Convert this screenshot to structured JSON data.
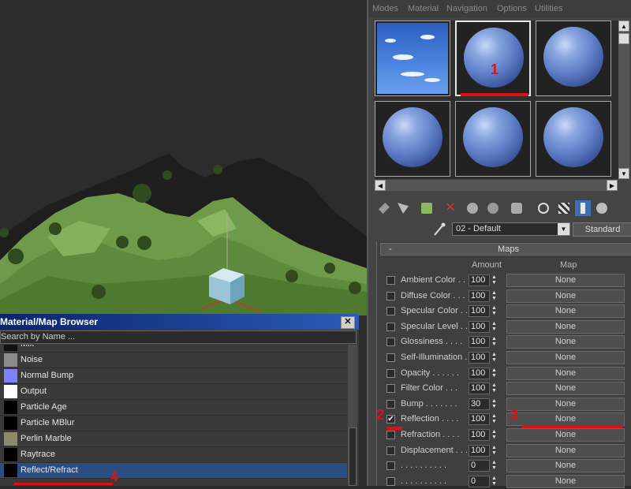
{
  "menu": [
    "Modes",
    "Material",
    "Navigation",
    "Options",
    "Utilities"
  ],
  "material_name": "02 - Default",
  "material_type": "Standard",
  "maps_rollout": {
    "title": "Maps",
    "collapse_symbol": "-",
    "col_amount": "Amount",
    "col_map": "Map",
    "rows": [
      {
        "label": "Ambient Color . .",
        "amount": "100",
        "map": "None",
        "checked": false
      },
      {
        "label": "Diffuse Color . . .",
        "amount": "100",
        "map": "None",
        "checked": false
      },
      {
        "label": "Specular Color . .",
        "amount": "100",
        "map": "None",
        "checked": false
      },
      {
        "label": "Specular Level . .",
        "amount": "100",
        "map": "None",
        "checked": false
      },
      {
        "label": "Glossiness . . . .",
        "amount": "100",
        "map": "None",
        "checked": false
      },
      {
        "label": "Self-Illumination .",
        "amount": "100",
        "map": "None",
        "checked": false
      },
      {
        "label": "Opacity . . . . . .",
        "amount": "100",
        "map": "None",
        "checked": false
      },
      {
        "label": "Filter Color . . .",
        "amount": "100",
        "map": "None",
        "checked": false
      },
      {
        "label": "Bump . . . . . . .",
        "amount": "30",
        "map": "None",
        "checked": false
      },
      {
        "label": "Reflection . . . .",
        "amount": "100",
        "map": "None",
        "checked": true
      },
      {
        "label": "Refraction . . . .",
        "amount": "100",
        "map": "None",
        "checked": false
      },
      {
        "label": "Displacement . . .",
        "amount": "100",
        "map": "None",
        "checked": false
      },
      {
        "label": ". . . . . . . . . .",
        "amount": "0",
        "map": "None",
        "checked": false
      },
      {
        "label": ". . . . . . . . . .",
        "amount": "0",
        "map": "None",
        "checked": false
      }
    ]
  },
  "browser": {
    "title": "Material/Map Browser",
    "close": "✕",
    "search_placeholder": "Search by Name ...",
    "items": [
      {
        "label": "Mix",
        "swatch": "#111111"
      },
      {
        "label": "Noise",
        "swatch": "#8a8a8a"
      },
      {
        "label": "Normal Bump",
        "swatch": "#8080ff"
      },
      {
        "label": "Output",
        "swatch": "#ffffff"
      },
      {
        "label": "Particle Age",
        "swatch": "#000000"
      },
      {
        "label": "Particle MBlur",
        "swatch": "#000000"
      },
      {
        "label": "Perlin Marble",
        "swatch": "#8b8a6a"
      },
      {
        "label": "Raytrace",
        "swatch": "#000000"
      },
      {
        "label": "Reflect/Refract",
        "swatch": "#000000",
        "selected": true
      }
    ]
  },
  "annotations": [
    "1",
    "2",
    "3",
    "4"
  ],
  "colors": {
    "accent_red": "#e01010",
    "selection_blue": "#2a4e82",
    "title_blue": "#0a246a",
    "terrain_green": "#6e9a4a"
  }
}
